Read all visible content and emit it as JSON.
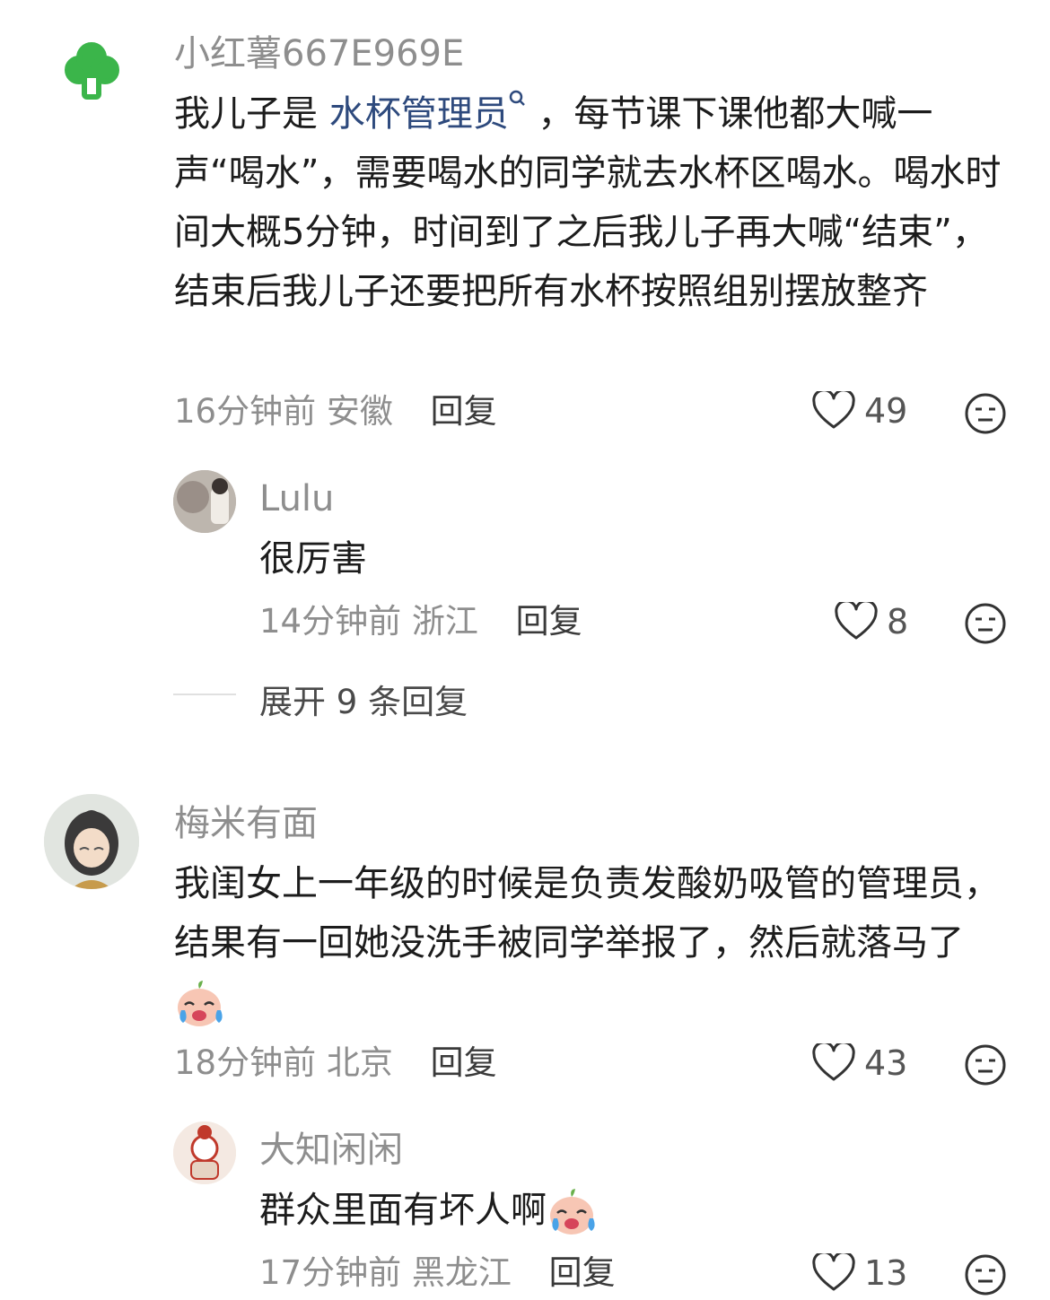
{
  "comments": [
    {
      "username": "小红薯667E969E",
      "text_before": "我儿子是",
      "topic_link": "水杯管理员",
      "text_after": "，每节课下课他都大喊一声“喝水”，需要喝水的同学就去水杯区喝水。喝水时间大概5分钟，时间到了之后我儿子再大喊“结束”，结束后我儿子还要把所有水杯按照组别摆放整齐",
      "time": "16分钟前",
      "location": "安徽",
      "reply_label": "回复",
      "likes": "49",
      "replies": [
        {
          "username": "Lulu",
          "text": "很厉害",
          "time": "14分钟前",
          "location": "浙江",
          "reply_label": "回复",
          "likes": "8"
        }
      ],
      "expand_label": "展开 9 条回复"
    },
    {
      "username": "梅米有面",
      "text": "我闺女上一年级的时候是负责发酸奶吸管的管理员，结果有一回她没洗手被同学举报了，然后就落马了",
      "time": "18分钟前",
      "location": "北京",
      "reply_label": "回复",
      "likes": "43",
      "replies": [
        {
          "username": "大知闲闲",
          "text": "群众里面有坏人啊",
          "time": "17分钟前",
          "location": "黑龙江",
          "reply_label": "回复",
          "likes": "13"
        }
      ]
    }
  ],
  "colors": {
    "link": "#2e4a7d",
    "meta": "#8e8e8e",
    "avatar_green": "#3bb54a"
  }
}
